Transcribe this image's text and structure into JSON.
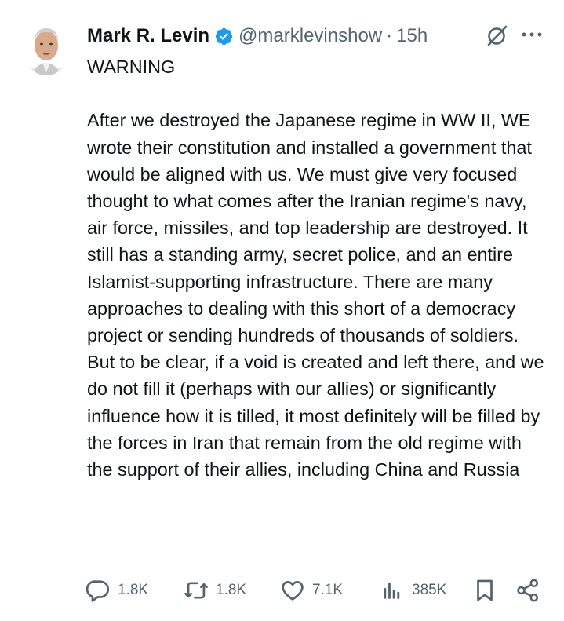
{
  "author": {
    "name": "Mark R. Levin",
    "handle": "@marklevinshow",
    "separator": "·",
    "time": "15h"
  },
  "tweet": {
    "text": "WARNING\n\nAfter we destroyed the Japanese regime in WW II, WE wrote their constitution and installed a government that would be aligned with us.  We must give very focused thought to what comes after the Iranian regime's navy, air force, missiles, and top leadership are destroyed.  It still has a standing army, secret police, and an entire Islamist-supporting infrastructure.  There are many approaches to dealing with this short of a democracy project or sending hundreds of thousands of soldiers.  But to be clear, if a void is created and left there, and we do not fill it (perhaps with our allies) or significantly influence how it is tilled, it most definitely will be filled by the forces in Iran that remain from the old regime with the support of their allies, including China and Russia"
  },
  "actions": {
    "replies": "1.8K",
    "reposts": "1.8K",
    "likes": "7.1K",
    "views": "385K"
  },
  "icons": {
    "verified": "verified-badge-icon",
    "grok": "grok-icon",
    "more": "more-icon",
    "reply": "reply-icon",
    "repost": "repost-icon",
    "like": "heart-icon",
    "views": "views-chart-icon",
    "bookmark": "bookmark-icon",
    "share": "share-icon"
  },
  "colors": {
    "text": "#0f1419",
    "secondary": "#536471",
    "verified": "#1d9bf0"
  }
}
